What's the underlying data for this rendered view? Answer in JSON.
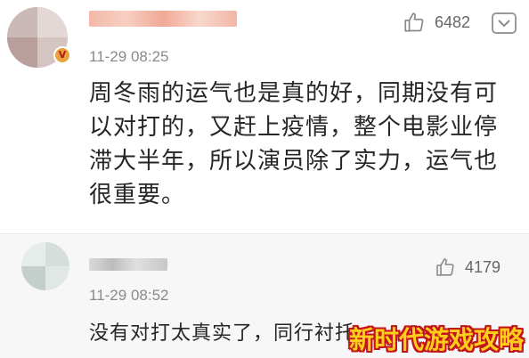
{
  "comments": [
    {
      "time": "11-29 08:25",
      "likes": "6482",
      "text": "周冬雨的运气也是真的好，同期没有可以对打的，又赶上疫情，整个电影业停滞大半年，所以演员除了实力，运气也很重要。",
      "verified_badge": "V"
    },
    {
      "time": "11-29 08:52",
      "likes": "4179",
      "text": "没有对打太真实了，同行衬托"
    }
  ],
  "watermark": "新时代游戏攻略",
  "colors": {
    "accent_badge": "#e8a23a",
    "watermark_fill": "#ffce1a",
    "watermark_stroke": "#c2151c"
  },
  "icons": {
    "like": "thumbs-up-icon",
    "more": "chevron-down-icon"
  }
}
